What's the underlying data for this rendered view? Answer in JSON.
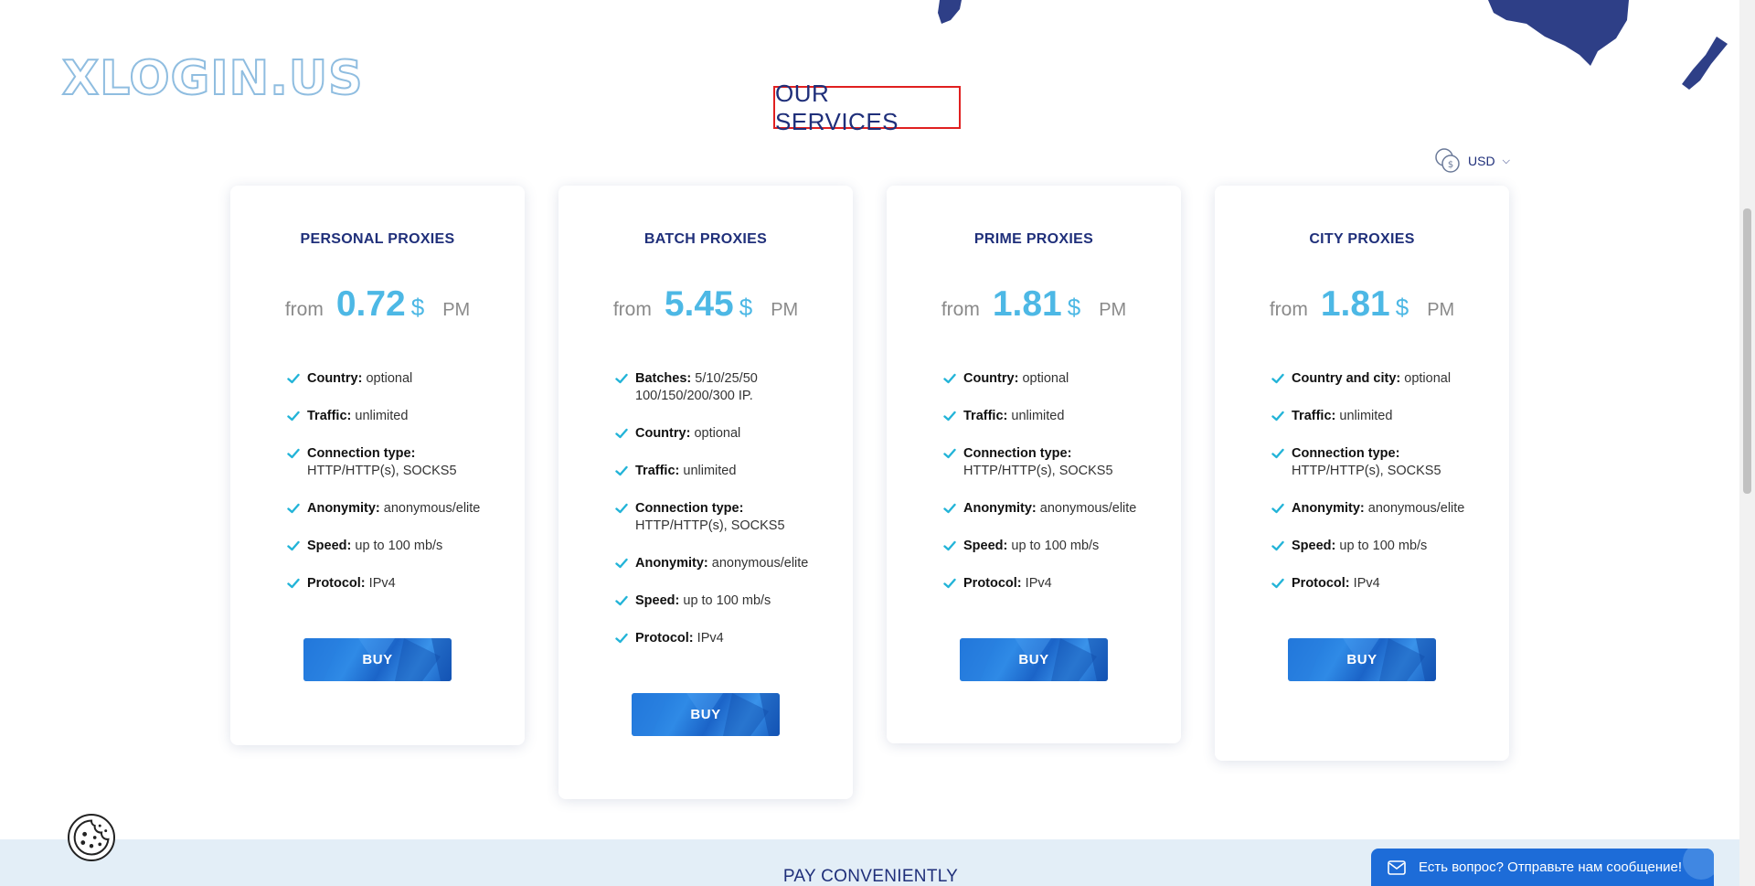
{
  "brand": {
    "logo_text": "XLOGIN.US"
  },
  "section": {
    "title": "OUR SERVICES"
  },
  "currency": {
    "selected": "USD",
    "icon": "coins-icon"
  },
  "colors": {
    "accent": "#4db8e5",
    "heading": "#1f2f7a",
    "button": "#1d6cd8",
    "check": "#23b4d8"
  },
  "cards": [
    {
      "title": "PERSONAL PROXIES",
      "from": "from",
      "price": "0.72",
      "currency": "$",
      "period": "PM",
      "features": [
        {
          "label": "Country:",
          "value": "optional"
        },
        {
          "label": "Traffic:",
          "value": "unlimited"
        },
        {
          "label": "Connection type:",
          "value": "HTTP/HTTP(s), SOCKS5"
        },
        {
          "label": "Anonymity:",
          "value": "anonymous/elite"
        },
        {
          "label": "Speed:",
          "value": "up to 100 mb/s"
        },
        {
          "label": "Protocol:",
          "value": "IPv4"
        }
      ],
      "button": "BUY"
    },
    {
      "title": "BATCH PROXIES",
      "from": "from",
      "price": "5.45",
      "currency": "$",
      "period": "PM",
      "features": [
        {
          "label": "Batches:",
          "value": "5/10/25/50 100/150/200/300 IP."
        },
        {
          "label": "Country:",
          "value": "optional"
        },
        {
          "label": "Traffic:",
          "value": "unlimited"
        },
        {
          "label": "Connection type:",
          "value": "HTTP/HTTP(s), SOCKS5"
        },
        {
          "label": "Anonymity:",
          "value": "anonymous/elite"
        },
        {
          "label": "Speed:",
          "value": "up to 100 mb/s"
        },
        {
          "label": "Protocol:",
          "value": "IPv4"
        }
      ],
      "button": "BUY"
    },
    {
      "title": "PRIME PROXIES",
      "from": "from",
      "price": "1.81",
      "currency": "$",
      "period": "PM",
      "features": [
        {
          "label": "Country:",
          "value": "optional"
        },
        {
          "label": "Traffic:",
          "value": "unlimited"
        },
        {
          "label": "Connection type:",
          "value": "HTTP/HTTP(s), SOCKS5"
        },
        {
          "label": "Anonymity:",
          "value": "anonymous/elite"
        },
        {
          "label": "Speed:",
          "value": "up to 100 mb/s"
        },
        {
          "label": "Protocol:",
          "value": "IPv4"
        }
      ],
      "button": "BUY"
    },
    {
      "title": "CITY PROXIES",
      "from": "from",
      "price": "1.81",
      "currency": "$",
      "period": "PM",
      "features": [
        {
          "label": "Country and city:",
          "value": "optional"
        },
        {
          "label": "Traffic:",
          "value": "unlimited"
        },
        {
          "label": "Connection type:",
          "value": "HTTP/HTTP(s), SOCKS5"
        },
        {
          "label": "Anonymity:",
          "value": "anonymous/elite"
        },
        {
          "label": "Speed:",
          "value": "up to 100 mb/s"
        },
        {
          "label": "Protocol:",
          "value": "IPv4"
        }
      ],
      "button": "BUY"
    }
  ],
  "pay": {
    "title": "PAY CONVENIENTLY"
  },
  "chat": {
    "label": "Есть вопрос? Отправьте нам сообщение!",
    "icon": "mail-icon"
  },
  "cookie": {
    "icon": "cookie-icon"
  }
}
